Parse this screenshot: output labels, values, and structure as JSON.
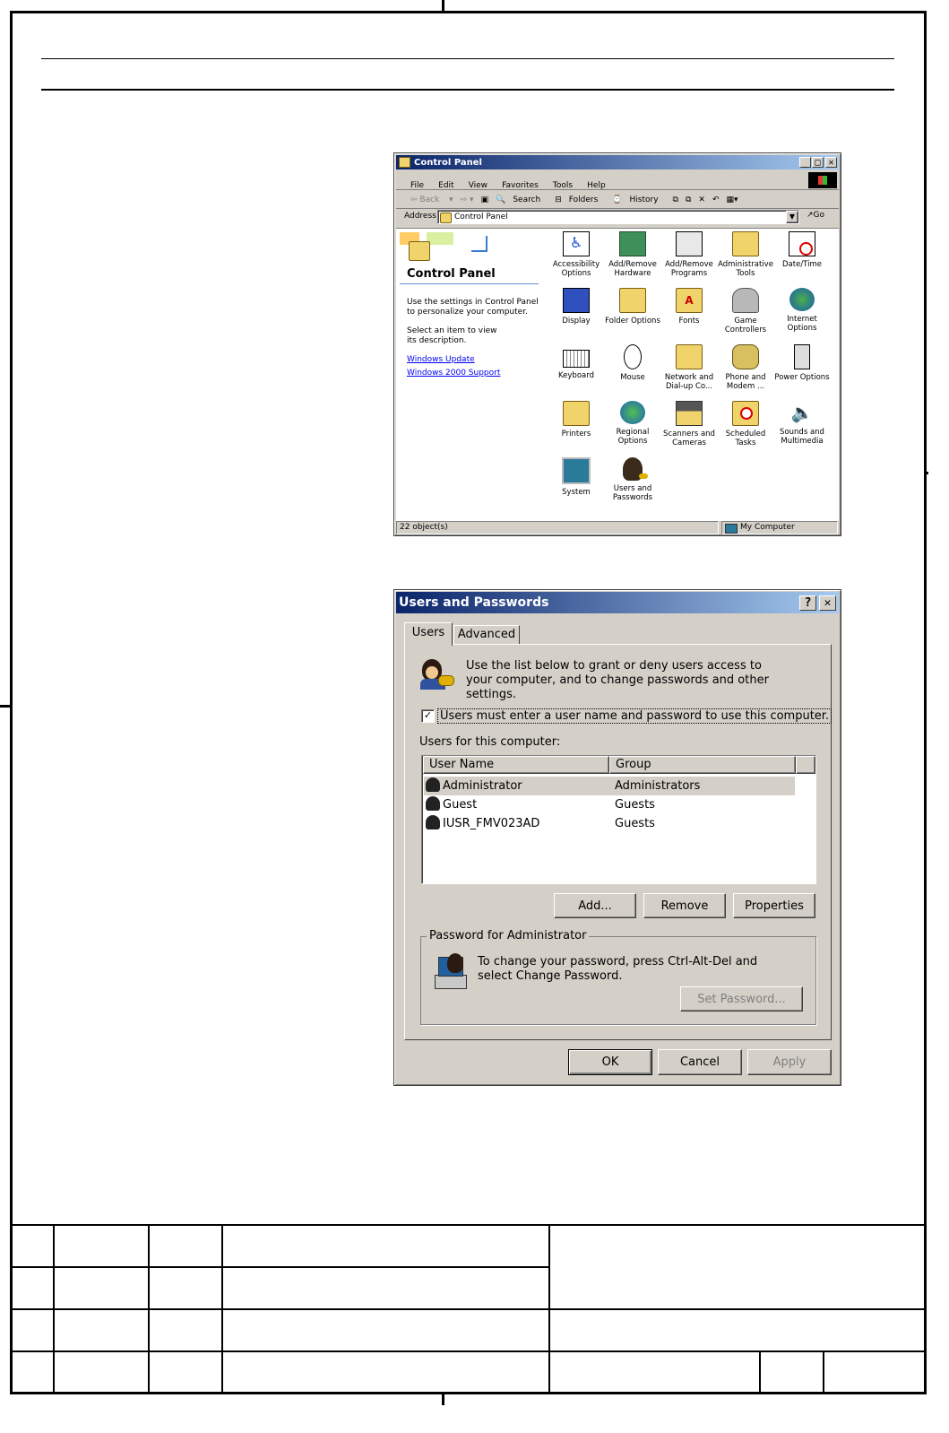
{
  "control_panel": {
    "title": "Control Panel",
    "menu": [
      "File",
      "Edit",
      "View",
      "Favorites",
      "Tools",
      "Help"
    ],
    "toolbar": {
      "back": "Back",
      "search": "Search",
      "folders": "Folders",
      "history": "History"
    },
    "address": {
      "label": "Address",
      "value": "Control Panel",
      "go": "Go"
    },
    "panel_heading": "Control Panel",
    "panel_text_1": "Use the settings in Control Panel to personalize your computer.",
    "panel_text_2": "Select an item to view its description.",
    "links": [
      "Windows Update",
      "Windows 2000 Support"
    ],
    "items": [
      "Accessibility Options",
      "Add/Remove Hardware",
      "Add/Remove Programs",
      "Administrative Tools",
      "Date/Time",
      "Display",
      "Folder Options",
      "Fonts",
      "Game Controllers",
      "Internet Options",
      "Keyboard",
      "Mouse",
      "Network and Dial-up Co...",
      "Phone and Modem ...",
      "Power Options",
      "Printers",
      "Regional Options",
      "Scanners and Cameras",
      "Scheduled Tasks",
      "Sounds and Multimedia",
      "System",
      "Users and Passwords"
    ],
    "status": {
      "count": "22 object(s)",
      "zone": "My Computer"
    }
  },
  "users_dialog": {
    "title": "Users and Passwords",
    "tabs": [
      "Users",
      "Advanced"
    ],
    "intro": "Use the list below to grant or deny users access to your computer, and to change passwords and other settings.",
    "checkbox_label": "Users must enter a user name and password to use this computer.",
    "checkbox_checked": true,
    "list_label": "Users for this computer:",
    "columns": [
      "User Name",
      "Group"
    ],
    "users": [
      {
        "name": "Administrator",
        "group": "Administrators"
      },
      {
        "name": "Guest",
        "group": "Guests"
      },
      {
        "name": "IUSR_FMV023AD",
        "group": "Guests"
      }
    ],
    "buttons": {
      "add": "Add...",
      "remove": "Remove",
      "properties": "Properties"
    },
    "password_group_title": "Password for Administrator",
    "password_text": "To change your password, press Ctrl-Alt-Del and select Change Password.",
    "set_password": "Set Password...",
    "footer": {
      "ok": "OK",
      "cancel": "Cancel",
      "apply": "Apply"
    }
  }
}
